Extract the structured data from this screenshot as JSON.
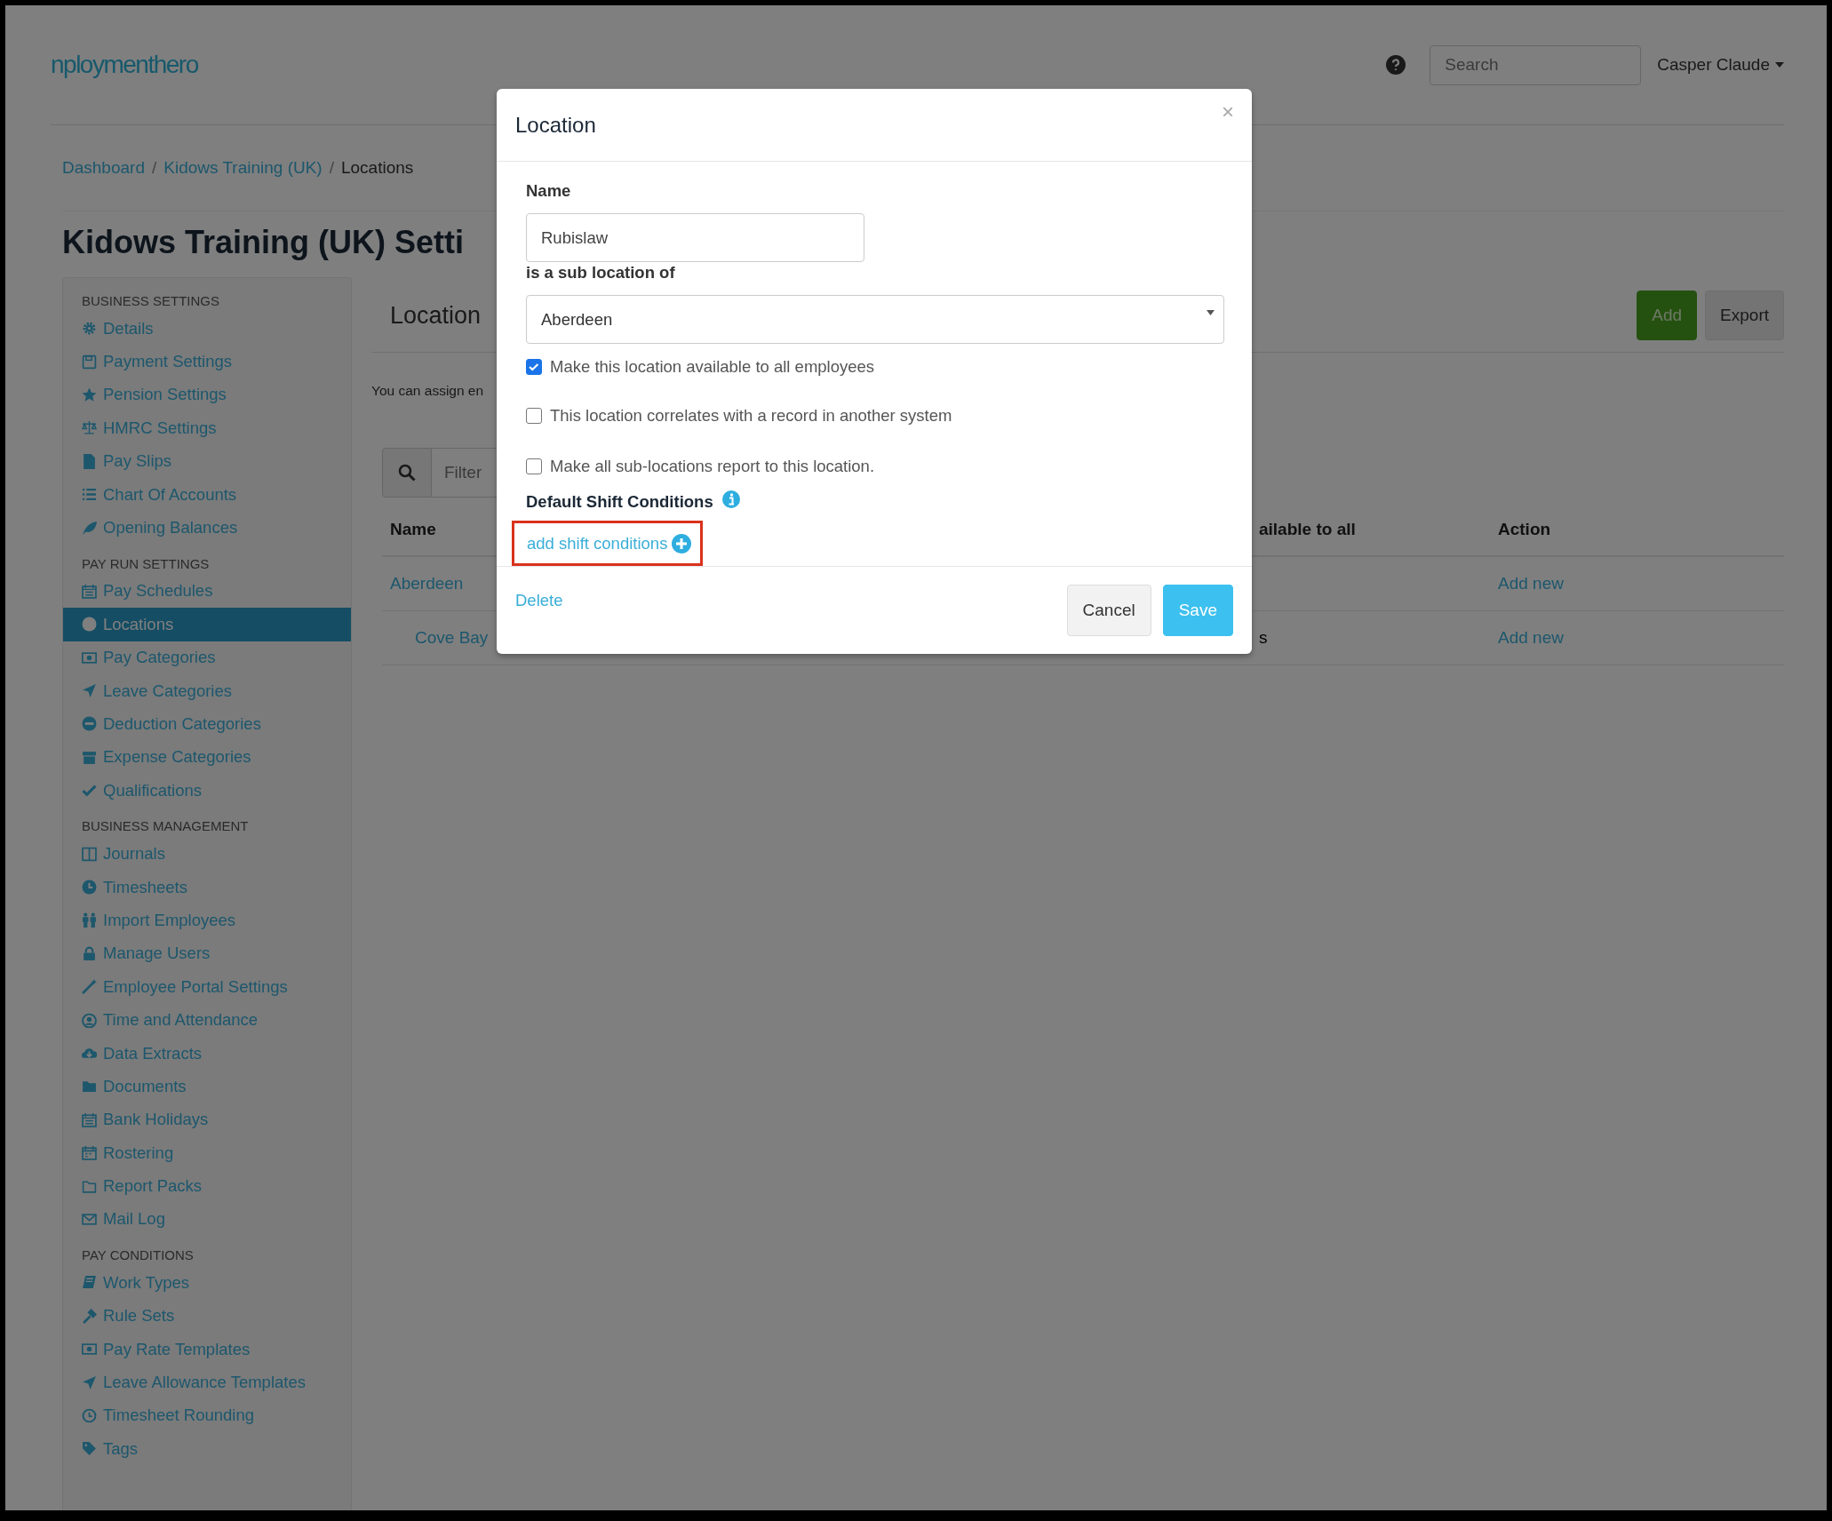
{
  "header": {
    "logo": "nploymenthero",
    "search": {
      "placeholder": "Search"
    },
    "user": "Casper Claude"
  },
  "breadcrumb": [
    {
      "label": "Dashboard",
      "current": false,
      "separator": "/"
    },
    {
      "label": "Kidows Training (UK)",
      "current": false,
      "separator": "/"
    },
    {
      "label": "Locations",
      "current": true
    }
  ],
  "title": "Kidows Training (UK) Setti",
  "sidebar": {
    "sections": [
      {
        "heading": "BUSINESS SETTINGS",
        "items": [
          {
            "label": "Details",
            "selected": false
          },
          {
            "label": "Payment Settings",
            "selected": false
          },
          {
            "label": "Pension Settings",
            "selected": false
          },
          {
            "label": "HMRC Settings",
            "selected": false
          },
          {
            "label": "Pay Slips",
            "selected": false
          },
          {
            "label": "Chart Of Accounts",
            "selected": false
          },
          {
            "label": "Opening Balances",
            "selected": false
          }
        ]
      },
      {
        "heading": "PAY RUN SETTINGS",
        "items": [
          {
            "label": "Pay Schedules",
            "selected": false
          },
          {
            "label": "Locations",
            "selected": true
          },
          {
            "label": "Pay Categories",
            "selected": false
          },
          {
            "label": "Leave Categories",
            "selected": false
          },
          {
            "label": "Deduction Categories",
            "selected": false
          },
          {
            "label": "Expense Categories",
            "selected": false
          },
          {
            "label": "Qualifications",
            "selected": false
          }
        ]
      },
      {
        "heading": "BUSINESS MANAGEMENT",
        "items": [
          {
            "label": "Journals",
            "selected": false
          },
          {
            "label": "Timesheets",
            "selected": false
          },
          {
            "label": "Import Employees",
            "selected": false
          },
          {
            "label": "Manage Users",
            "selected": false
          },
          {
            "label": "Employee Portal Settings",
            "selected": false
          },
          {
            "label": "Time and Attendance",
            "selected": false
          },
          {
            "label": "Data Extracts",
            "selected": false
          },
          {
            "label": "Documents",
            "selected": false
          },
          {
            "label": "Bank Holidays",
            "selected": false
          },
          {
            "label": "Rostering",
            "selected": false
          },
          {
            "label": "Report Packs",
            "selected": false
          },
          {
            "label": "Mail Log",
            "selected": false
          }
        ]
      },
      {
        "heading": "PAY CONDITIONS",
        "items": [
          {
            "label": "Work Types",
            "selected": false
          },
          {
            "label": "Rule Sets",
            "selected": false
          },
          {
            "label": "Pay Rate Templates",
            "selected": false
          },
          {
            "label": "Leave Allowance Templates",
            "selected": false
          },
          {
            "label": "Timesheet Rounding",
            "selected": false
          },
          {
            "label": "Tags",
            "selected": false
          }
        ]
      }
    ]
  },
  "main": {
    "heading": "Location",
    "buttons": [
      {
        "label": "Add",
        "kind": "primary"
      },
      {
        "label": "Export",
        "kind": "default"
      }
    ],
    "intro": "You can assign en",
    "filter": {
      "placeholder": "Filter"
    },
    "table": {
      "columns": [
        "Name",
        "ailable to all",
        "Action"
      ],
      "rows": [
        {
          "name": "Aberdeen",
          "action": "Add new",
          "children": [
            {
              "name": "Cove Bay",
              "column_2": "s",
              "action": "Add new"
            }
          ]
        }
      ]
    }
  },
  "modal": {
    "title": "Location",
    "close": "×",
    "name_label": "Name",
    "name_value": "Rubislaw",
    "parent_label": "is a sub location of",
    "parent_value": "Aberdeen",
    "checkboxes": [
      {
        "label": "Make this location available to all employees",
        "checked": true
      },
      {
        "label": "This location correlates with a record in another system",
        "checked": false
      },
      {
        "label": "Make all sub-locations report to this location.",
        "checked": false
      }
    ],
    "section_heading": "Default Shift Conditions",
    "add_link": "add shift conditions",
    "highlighted": true,
    "delete": "Delete",
    "buttons": [
      {
        "label": "Cancel",
        "kind": "default"
      },
      {
        "label": "Save",
        "kind": "primary"
      }
    ]
  }
}
